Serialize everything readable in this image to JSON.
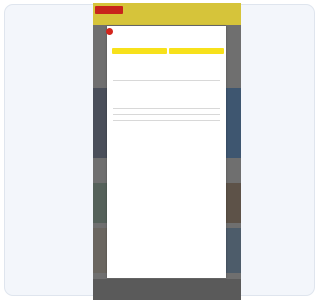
{
  "site": {
    "logo_text": "",
    "nav_items": [
      "",
      "",
      "",
      "",
      "",
      ""
    ],
    "utility_text": ""
  },
  "modal": {
    "title": "",
    "option_left": {
      "heading": "",
      "description": "",
      "button_label": "",
      "note": ""
    },
    "option_right": {
      "heading": "",
      "description": "",
      "button_label": "",
      "note": ""
    },
    "section_heading": "",
    "section_lines": [
      "",
      "",
      "",
      ""
    ],
    "subheading": "",
    "list_lines": [
      "",
      "",
      "",
      "",
      ""
    ],
    "footer_text": "",
    "footer_links": [
      "",
      ""
    ]
  },
  "colors": {
    "accent_yellow": "#f7e11b",
    "brand_red": "#d3251c",
    "header_bar": "#d6c43a"
  }
}
